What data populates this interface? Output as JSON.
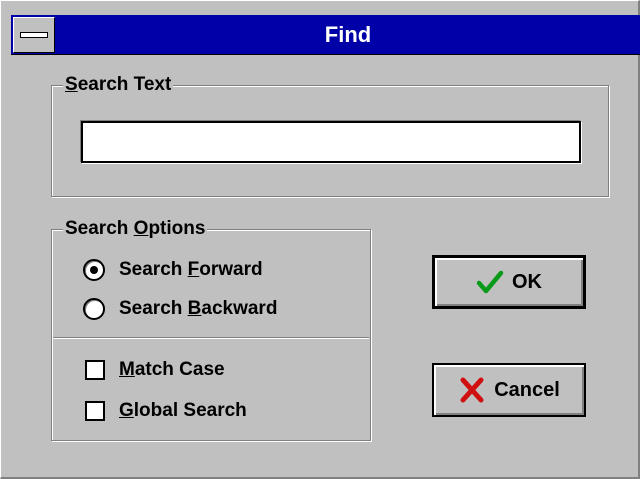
{
  "window": {
    "title": "Find"
  },
  "search_text_group": {
    "label_mnemonic": "S",
    "label_rest": "earch Text",
    "input_value": ""
  },
  "search_options_group": {
    "label_prefix": "Search ",
    "label_mnemonic": "O",
    "label_rest": "ptions",
    "radio_options": [
      {
        "prefix": "Search ",
        "mnemonic": "F",
        "rest": "orward",
        "checked": true
      },
      {
        "prefix": "Search ",
        "mnemonic": "B",
        "rest": "ackward",
        "checked": false
      }
    ],
    "checkboxes": [
      {
        "prefix": "",
        "mnemonic": "M",
        "rest": "atch Case",
        "checked": false
      },
      {
        "prefix": "",
        "mnemonic": "G",
        "rest": "lobal Search",
        "checked": false
      }
    ]
  },
  "buttons": {
    "ok_label": "OK",
    "cancel_label": "Cancel"
  },
  "icons": {
    "ok": "checkmark-icon",
    "cancel": "x-icon",
    "system_menu": "system-menu-icon"
  },
  "colors": {
    "title_bar": "#0000a8",
    "face": "#c0c0c0",
    "check_green": "#0a9a1a",
    "x_red": "#d01010"
  }
}
